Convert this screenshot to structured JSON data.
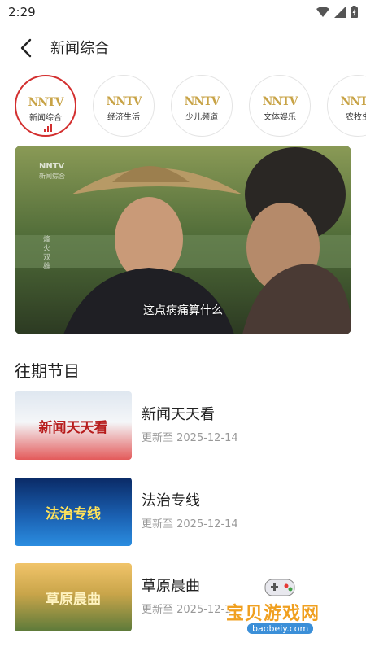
{
  "status_bar": {
    "time": "2:29"
  },
  "header": {
    "title": "新闻综合"
  },
  "channels": [
    {
      "logo": "NNTV",
      "label": "新闻综合",
      "active": true
    },
    {
      "logo": "NNTV",
      "label": "经济生活",
      "active": false
    },
    {
      "logo": "NNTV",
      "label": "少儿频道",
      "active": false
    },
    {
      "logo": "NNTV",
      "label": "文体娱乐",
      "active": false
    },
    {
      "logo": "NNTV",
      "label": "农牧生",
      "active": false
    }
  ],
  "player": {
    "watermark_logo": "NNTV",
    "watermark_channel": "新闻综合",
    "side_caption": "烽火双雄",
    "subtitle": "这点病痛算什么"
  },
  "section": {
    "title": "往期节目"
  },
  "programs": [
    {
      "title": "新闻天天看",
      "updated": "更新至 2025-12-14",
      "thumb_text": "新闻天天看"
    },
    {
      "title": "法治专线",
      "updated": "更新至 2025-12-14",
      "thumb_text": "法治专线"
    },
    {
      "title": "草原晨曲",
      "updated": "更新至 2025-12-14",
      "thumb_text": "草原晨曲"
    }
  ],
  "watermark": {
    "brand": "宝贝游戏网",
    "url": "baobeiy.com"
  },
  "colors": {
    "accent": "#d32f2f",
    "logo_gold": "#c8a346",
    "muted": "#999999"
  }
}
